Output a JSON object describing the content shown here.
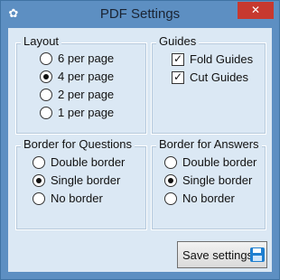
{
  "window": {
    "title": "PDF Settings",
    "close_symbol": "✕",
    "app_icon": "gear-icon"
  },
  "layout_group": {
    "label": "Layout",
    "options": [
      {
        "label": "6 per page",
        "checked": false
      },
      {
        "label": "4 per page",
        "checked": true
      },
      {
        "label": "2 per page",
        "checked": false
      },
      {
        "label": "1 per page",
        "checked": false
      }
    ]
  },
  "guides_group": {
    "label": "Guides",
    "options": [
      {
        "label": "Fold Guides",
        "checked": true
      },
      {
        "label": "Cut Guides",
        "checked": true
      }
    ]
  },
  "questions_border_group": {
    "label": "Border for Questions",
    "options": [
      {
        "label": "Double border",
        "checked": false
      },
      {
        "label": "Single border",
        "checked": true
      },
      {
        "label": "No border",
        "checked": false
      }
    ]
  },
  "answers_border_group": {
    "label": "Border for Answers",
    "options": [
      {
        "label": "Double border",
        "checked": false
      },
      {
        "label": "Single border",
        "checked": true
      },
      {
        "label": "No border",
        "checked": false
      }
    ]
  },
  "save_button": {
    "label": "Save settings",
    "icon": "floppy-disk-icon"
  }
}
